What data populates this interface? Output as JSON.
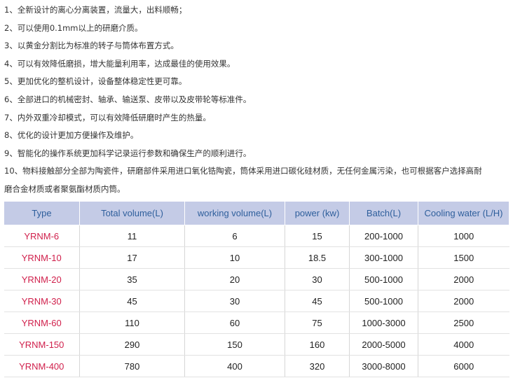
{
  "features": [
    "1、全新设计的离心分离装置，流量大，出料顺畅；",
    "2、可以使用0.1mm以上的研磨介质。",
    "3、以黄金分割比为标准的转子与筒体布置方式。",
    "4、可以有效降低磨损，增大能量利用率，达成最佳的使用效果。",
    "5、更加优化的整机设计，设备整体稳定性更可靠。",
    "6、全部进口的机械密封、轴承、输送泵、皮带以及皮带轮等标准件。",
    "7、内外双重冷却模式，可以有效降低研磨时产生的热量。",
    "8、优化的设计更加方便操作及维护。",
    "9、智能化的操作系统更加科学记录运行参数和确保生产的顺利进行。",
    "10、物料接触部分全部为陶瓷件，研磨部件采用进口氧化锆陶瓷，筒体采用进口碳化硅材质，无任何金属污染，也可根据客户选择高耐",
    "磨合金材质或者聚氨酯材质内筒。"
  ],
  "table": {
    "headers": [
      "Type",
      "Total volume(L)",
      "working volume(L)",
      "power (kw)",
      "Batch(L)",
      "Cooling water (L/H)"
    ],
    "rows": [
      [
        "YRNM-6",
        "11",
        "6",
        "15",
        "200-1000",
        "1000"
      ],
      [
        "YRNM-10",
        "17",
        "10",
        "18.5",
        "300-1000",
        "1500"
      ],
      [
        "YRNM-20",
        "35",
        "20",
        "30",
        "500-1000",
        "2000"
      ],
      [
        "YRNM-30",
        "45",
        "30",
        "45",
        "500-1000",
        "2000"
      ],
      [
        "YRNM-60",
        "110",
        "60",
        "75",
        "1000-3000",
        "2500"
      ],
      [
        "YRNM-150",
        "290",
        "150",
        "160",
        "2000-5000",
        "4000"
      ],
      [
        "YRNM-400",
        "780",
        "400",
        "320",
        "3000-8000",
        "6000"
      ]
    ]
  },
  "colors": {
    "header_bg": "#c4cbe6",
    "header_text": "#2f5f9c",
    "type_text": "#d01f4b"
  }
}
